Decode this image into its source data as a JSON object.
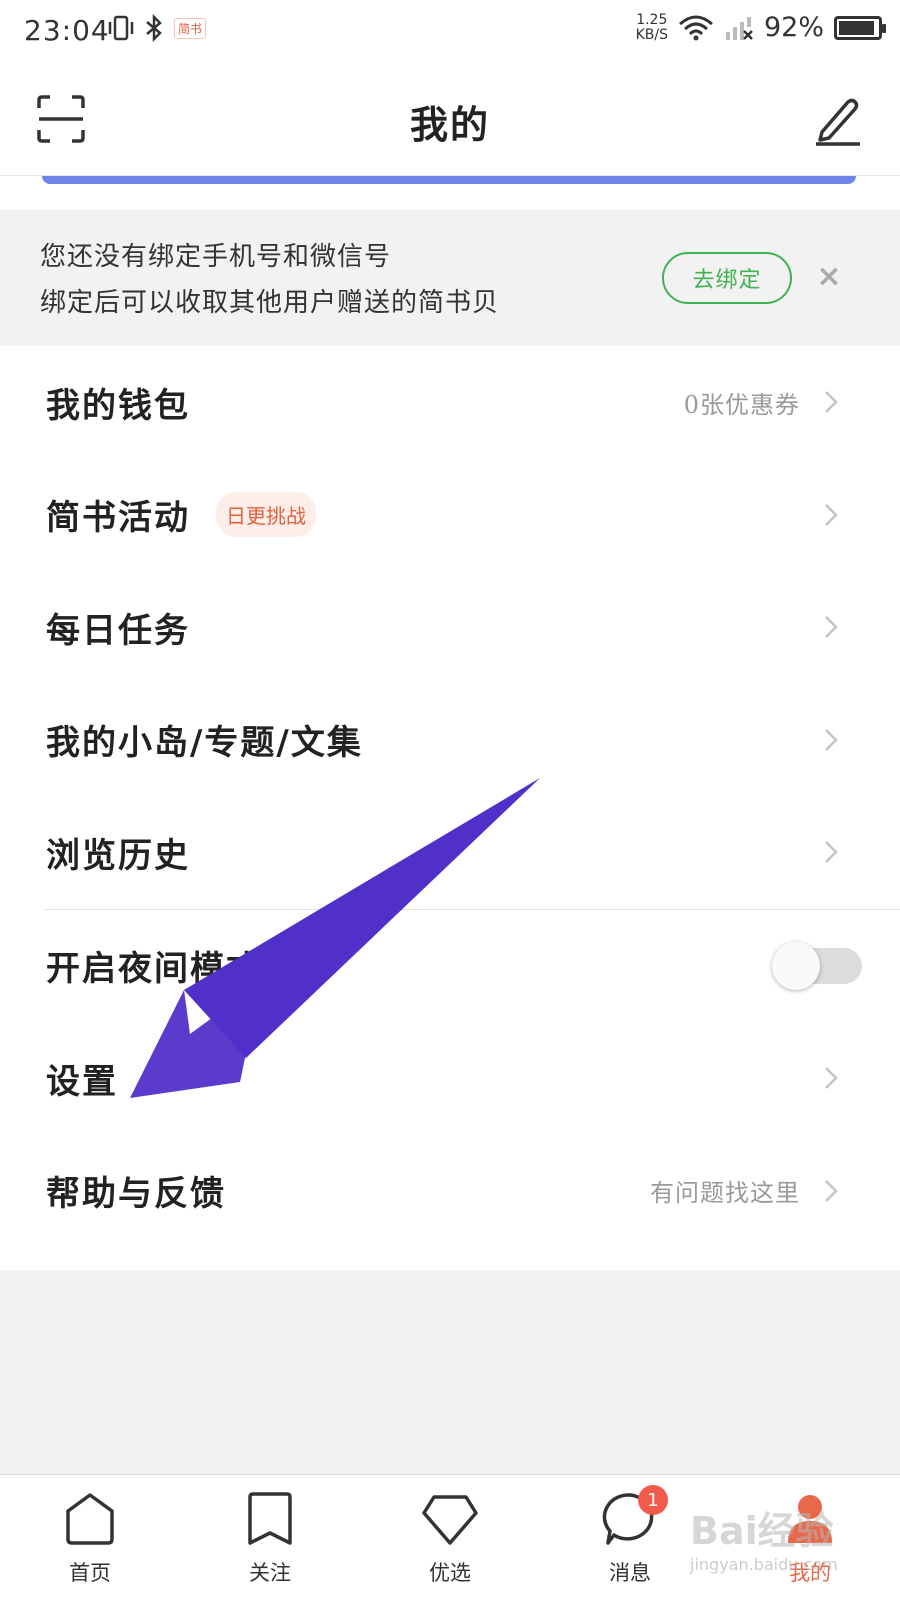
{
  "status_bar": {
    "time": "23:04",
    "app_badge": "简书",
    "speed_value": "1.25",
    "speed_unit": "KB/S",
    "battery": "92%",
    "battery_level": 0.92
  },
  "header": {
    "title": "我的"
  },
  "bind_banner": {
    "line1": "您还没有绑定手机号和微信号",
    "line2": "绑定后可以收取其他用户赠送的简书贝",
    "button": "去绑定",
    "close": "×"
  },
  "menu": {
    "wallet": {
      "label": "我的钱包",
      "hint": "0张优惠券"
    },
    "activity": {
      "label": "简书活动",
      "tag": "日更挑战"
    },
    "tasks": {
      "label": "每日任务"
    },
    "islands": {
      "label": "我的小岛/专题/文集"
    },
    "history": {
      "label": "浏览历史"
    },
    "night_mode": {
      "label": "开启夜间模式",
      "enabled": false
    },
    "settings": {
      "label": "设置"
    },
    "help": {
      "label": "帮助与反馈",
      "hint": "有问题找这里"
    }
  },
  "bottom_nav": {
    "home": "首页",
    "follow": "关注",
    "featured": "优选",
    "messages": "消息",
    "messages_badge": "1",
    "me": "我的"
  },
  "watermark": {
    "text": "Bai经验",
    "url": "jingyan.baidu.com"
  },
  "colors": {
    "accent_green": "#42b250",
    "accent_orange": "#e8684a",
    "annotation_arrow": "#5130c9",
    "banner_bg": "#f2f2f2"
  }
}
